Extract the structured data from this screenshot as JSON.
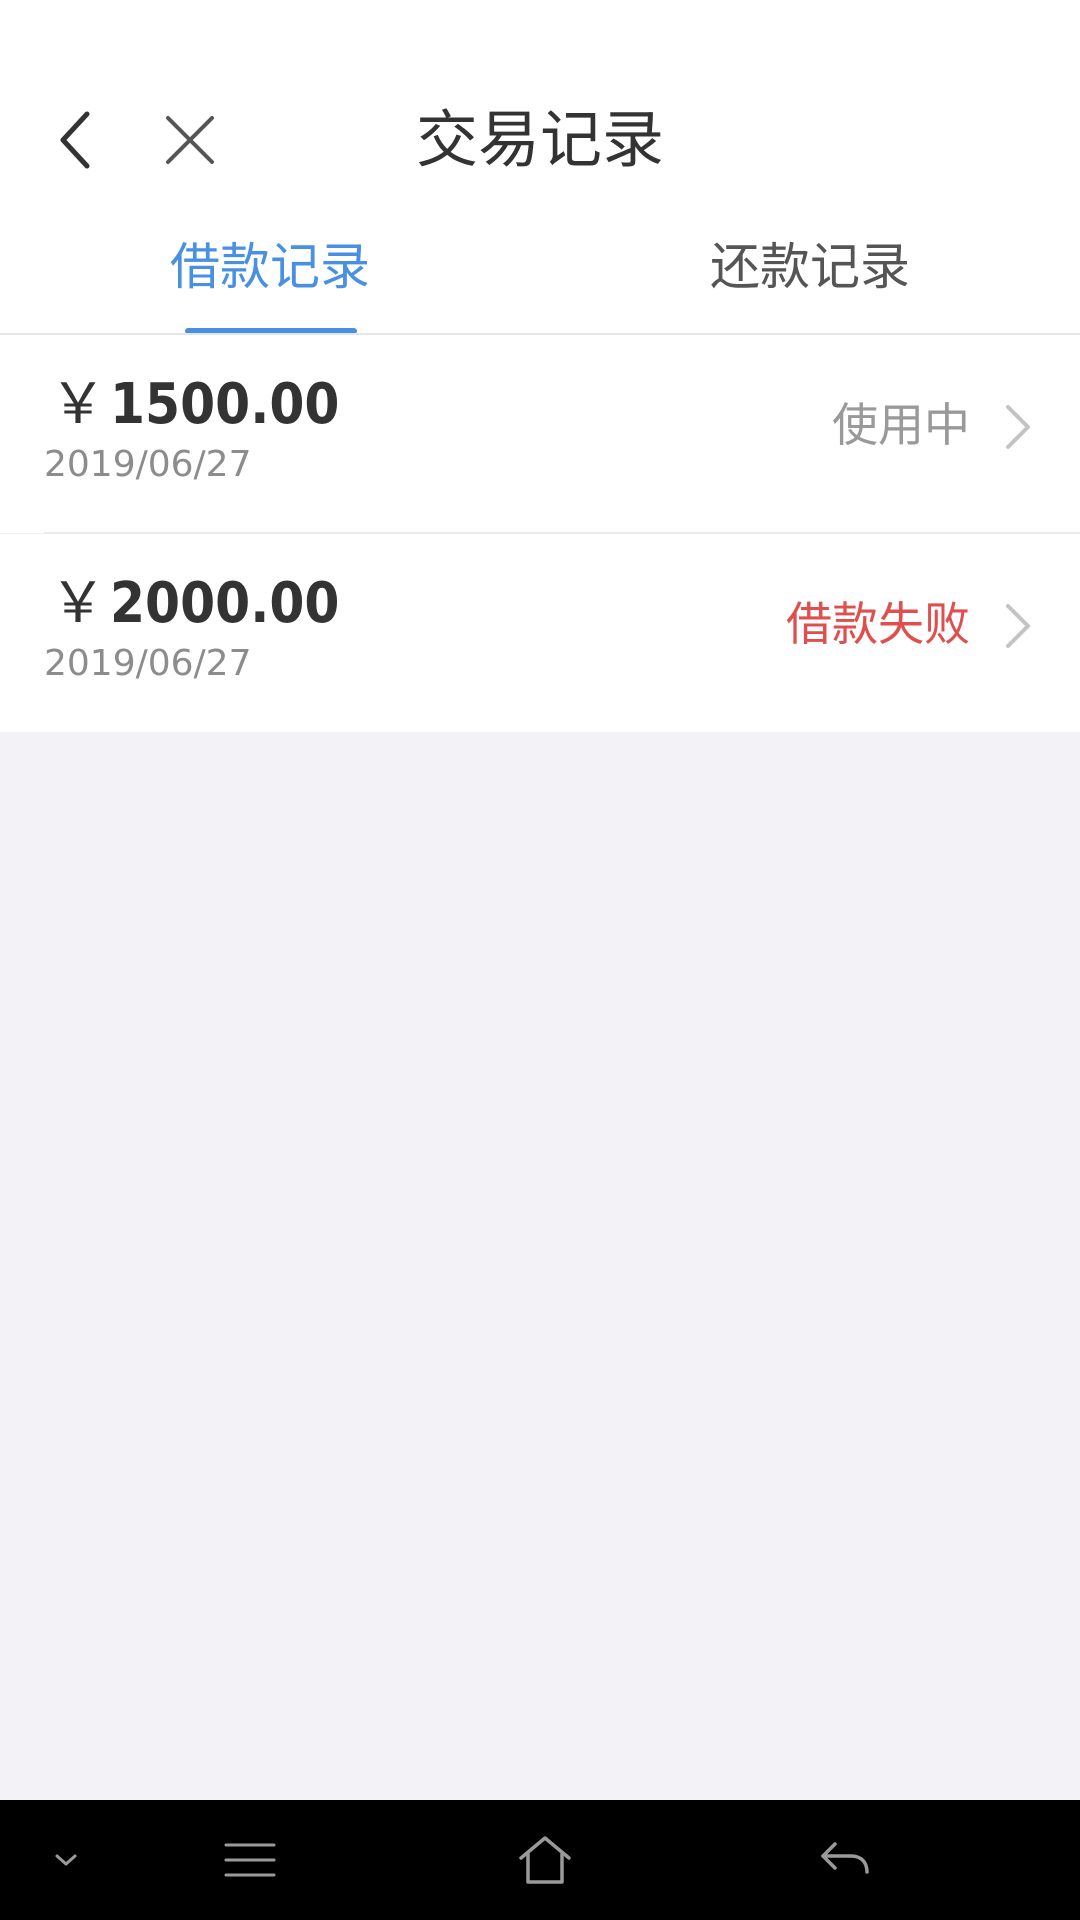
{
  "header": {
    "title": "交易记录",
    "back_icon": "chevron-left-icon",
    "close_icon": "close-icon"
  },
  "tabs": [
    {
      "label": "借款记录",
      "active": true
    },
    {
      "label": "还款记录",
      "active": false
    }
  ],
  "records": [
    {
      "currency": "￥",
      "amount": "1500.00",
      "date": "2019/06/27",
      "status": "使用中",
      "status_color": "#999999"
    },
    {
      "currency": "￥",
      "amount": "2000.00",
      "date": "2019/06/27",
      "status": "借款失败",
      "status_color": "#e04e4e"
    }
  ],
  "colors": {
    "accent": "#4a90e2",
    "title_text": "#333333",
    "secondary_text": "#8c8c8c",
    "error": "#e04e4e",
    "page_background": "#f2f2f7"
  },
  "navbar": {
    "icons": [
      "chevron-down-icon",
      "menu-icon",
      "home-icon",
      "back-arrow-icon"
    ]
  }
}
